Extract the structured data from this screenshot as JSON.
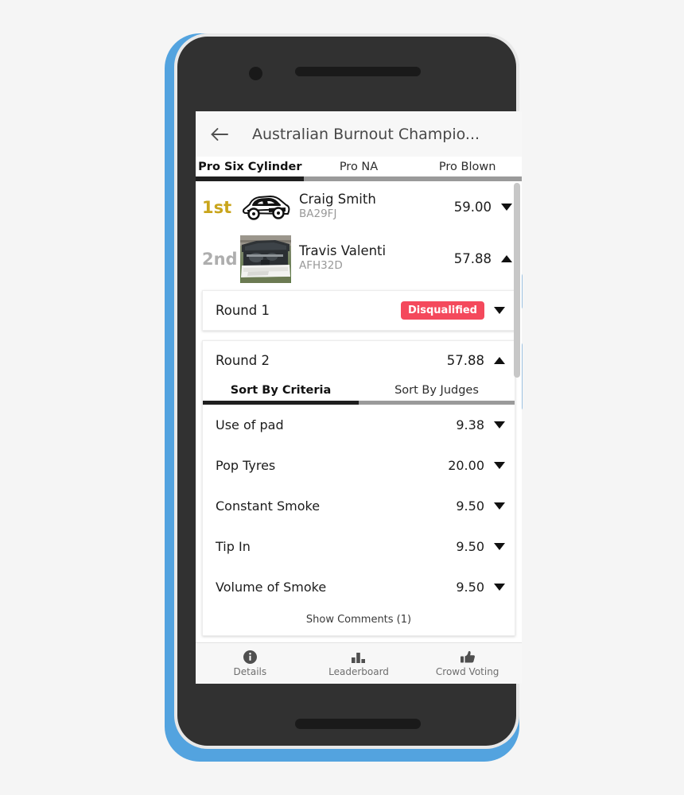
{
  "app": {
    "title": "Australian Burnout Champio...",
    "back_icon": "arrow-left-icon"
  },
  "tabs": [
    {
      "label": "Pro Six Cylinder",
      "active": true
    },
    {
      "label": "Pro NA",
      "active": false
    },
    {
      "label": "Pro Blown",
      "active": false
    }
  ],
  "competitors": [
    {
      "place": "1st",
      "place_color": "#c9a51c",
      "name": "Craig Smith",
      "plate": "BA29FJ",
      "score": "59.00",
      "expanded": false,
      "thumb": "car-line-art-icon"
    },
    {
      "place": "2nd",
      "place_color": "#aeaeae",
      "name": "Travis Valenti",
      "plate": "AFH32D",
      "score": "57.88",
      "expanded": true,
      "thumb": "car-photo-open-hood"
    }
  ],
  "rounds": [
    {
      "title": "Round 1",
      "status_badge": "Disqualified",
      "badge_color": "#f4495c",
      "score": "",
      "expanded": false
    },
    {
      "title": "Round 2",
      "status_badge": "",
      "score": "57.88",
      "expanded": true,
      "sort_tabs": [
        {
          "label": "Sort By Criteria",
          "active": true
        },
        {
          "label": "Sort By Judges",
          "active": false
        }
      ],
      "criteria": [
        {
          "label": "Use of pad",
          "score": "9.38"
        },
        {
          "label": "Pop Tyres",
          "score": "20.00"
        },
        {
          "label": "Constant Smoke",
          "score": "9.50"
        },
        {
          "label": "Tip In",
          "score": "9.50"
        },
        {
          "label": "Volume of Smoke",
          "score": "9.50"
        }
      ],
      "show_comments": "Show Comments (1)"
    }
  ],
  "bottom_nav": [
    {
      "label": "Details",
      "icon": "info-circle-icon"
    },
    {
      "label": "Leaderboard",
      "icon": "bar-chart-icon"
    },
    {
      "label": "Crowd Voting",
      "icon": "thumbs-up-icon"
    }
  ],
  "colors": {
    "accent_gold": "#c9a51c",
    "danger": "#f4495c",
    "indicator_active": "#1f1f1f",
    "indicator_track": "#9a9a9a",
    "phone_shell": "#53a3df"
  }
}
